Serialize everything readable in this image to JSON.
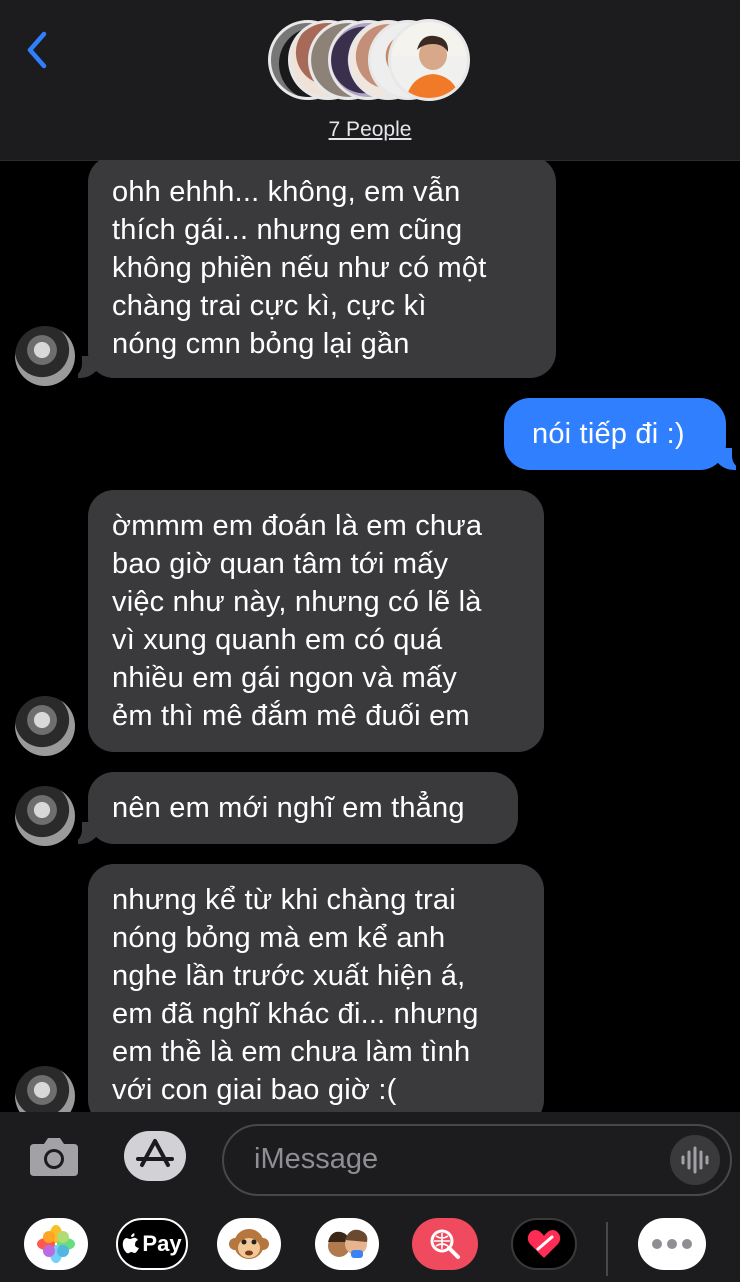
{
  "header": {
    "people_label": "7 People",
    "back_icon": "chevron-left-icon",
    "accent": "#2f7fff"
  },
  "messages": [
    {
      "direction": "incoming",
      "text_lines": [
        "ohh ehhh... không, em vẫn",
        "thích gái... nhưng em cũng",
        "không phiền nếu như có một",
        "chàng trai cực kì, cực kì",
        "nóng cmn bỏng lại gần"
      ]
    },
    {
      "direction": "outgoing",
      "text_lines": [
        "nói tiếp đi :)"
      ]
    },
    {
      "direction": "incoming",
      "text_lines": [
        "ờmmm em đoán là em chưa",
        "bao giờ quan tâm tới mấy",
        "việc như này, nhưng có lẽ là",
        "vì xung quanh em có quá",
        "nhiều em gái ngon và mấy",
        "ẻm thì mê đắm mê đuối em"
      ]
    },
    {
      "direction": "incoming",
      "text_lines": [
        "nên em mới nghĩ em thẳng"
      ]
    },
    {
      "direction": "incoming",
      "text_lines": [
        "nhưng kể từ khi chàng trai",
        "nóng bỏng mà em kể anh",
        "nghe lần trước xuất hiện á,",
        "em đã nghĩ khác đi... nhưng",
        "em thề là em chưa làm tình",
        "với con giai bao giờ :("
      ]
    }
  ],
  "input": {
    "placeholder": "iMessage",
    "camera_icon": "camera-icon",
    "appstore_icon": "app-store-icon",
    "audio_icon": "audio-waveform-icon"
  },
  "tray": {
    "apps": [
      "photos-icon",
      "apple-pay-icon",
      "animoji-icon",
      "memoji-stickers-icon",
      "images-search-icon",
      "digital-touch-icon",
      "more-icon"
    ],
    "apple_pay_label": "Pay"
  },
  "colors": {
    "incoming_bubble": "#3a3a3c",
    "outgoing_bubble": "#2f7fff",
    "bar_background": "#1c1c1e"
  }
}
